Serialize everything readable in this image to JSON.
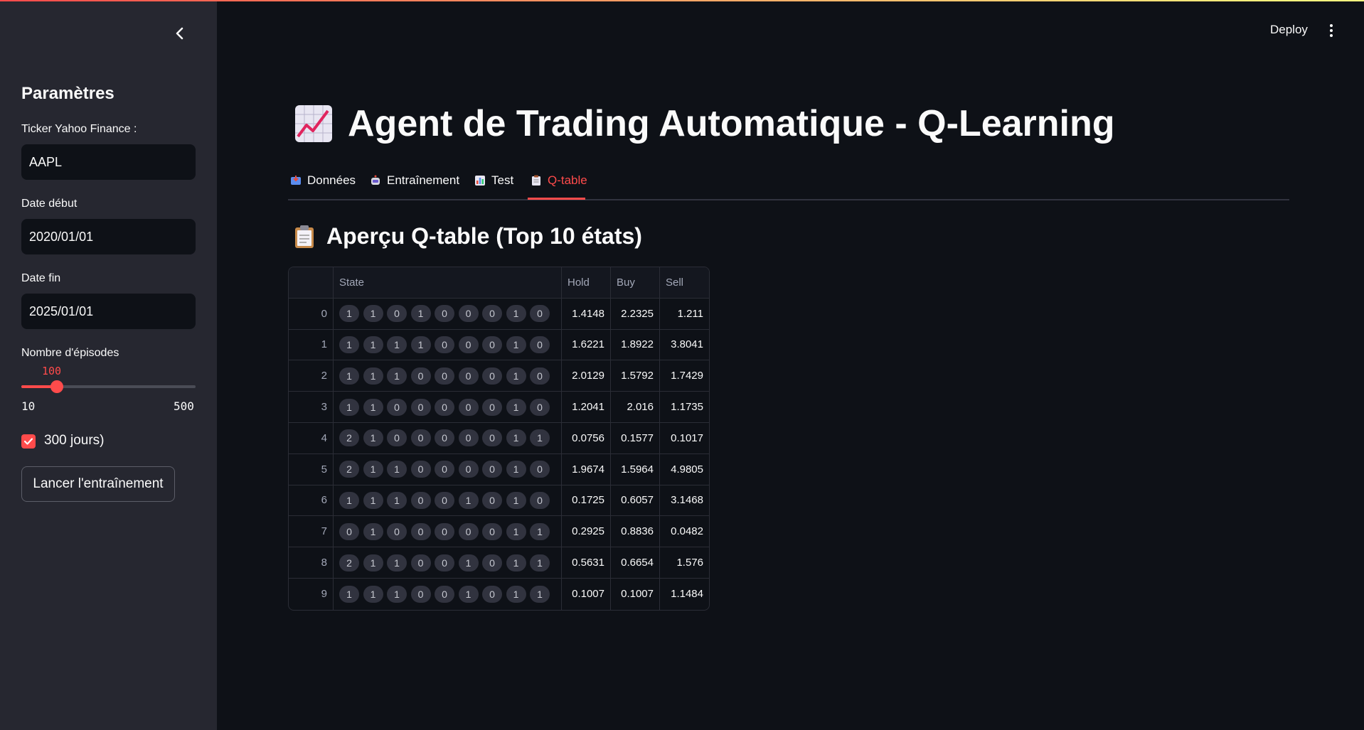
{
  "colors": {
    "accent": "#ff4b4b",
    "sidebar_bg": "#262730",
    "main_bg": "#0e1117"
  },
  "sidebar": {
    "collapse_icon": "chevron-left-icon",
    "title": "Paramètres",
    "ticker_label": "Ticker Yahoo Finance :",
    "ticker_value": "AAPL",
    "start_label": "Date début",
    "start_value": "2020/01/01",
    "end_label": "Date fin",
    "end_value": "2025/01/01",
    "episodes_label": "Nombre d'épisodes",
    "episodes_value": "100",
    "episodes_min": "10",
    "episodes_max": "500",
    "checkbox_checked": true,
    "checkbox_label": "300 jours)",
    "train_button": "Lancer l'entraînement"
  },
  "header": {
    "deploy": "Deploy",
    "menu_icon": "more-vertical-icon"
  },
  "main": {
    "title": "Agent de Trading Automatique - Q-Learning",
    "title_icon": "chart-increasing-icon",
    "tabs": [
      {
        "label": "Données",
        "icon": "inbox-icon"
      },
      {
        "label": "Entraînement",
        "icon": "robot-icon"
      },
      {
        "label": "Test",
        "icon": "bar-chart-icon"
      },
      {
        "label": "Q-table",
        "icon": "clipboard-icon",
        "active": true
      }
    ],
    "section_title": "Aperçu Q-table (Top 10 états)",
    "section_icon": "clipboard-icon",
    "table": {
      "columns": [
        "",
        "State",
        "Hold",
        "Buy",
        "Sell"
      ],
      "rows": [
        {
          "index": "0",
          "state": [
            "1",
            "1",
            "0",
            "1",
            "0",
            "0",
            "0",
            "1",
            "0"
          ],
          "hold": "1.4148",
          "buy": "2.2325",
          "sell": "1.211"
        },
        {
          "index": "1",
          "state": [
            "1",
            "1",
            "1",
            "1",
            "0",
            "0",
            "0",
            "1",
            "0"
          ],
          "hold": "1.6221",
          "buy": "1.8922",
          "sell": "3.8041"
        },
        {
          "index": "2",
          "state": [
            "1",
            "1",
            "1",
            "0",
            "0",
            "0",
            "0",
            "1",
            "0"
          ],
          "hold": "2.0129",
          "buy": "1.5792",
          "sell": "1.7429"
        },
        {
          "index": "3",
          "state": [
            "1",
            "1",
            "0",
            "0",
            "0",
            "0",
            "0",
            "1",
            "0"
          ],
          "hold": "1.2041",
          "buy": "2.016",
          "sell": "1.1735"
        },
        {
          "index": "4",
          "state": [
            "2",
            "1",
            "0",
            "0",
            "0",
            "0",
            "0",
            "1",
            "1"
          ],
          "hold": "0.0756",
          "buy": "0.1577",
          "sell": "0.1017"
        },
        {
          "index": "5",
          "state": [
            "2",
            "1",
            "1",
            "0",
            "0",
            "0",
            "0",
            "1",
            "0"
          ],
          "hold": "1.9674",
          "buy": "1.5964",
          "sell": "4.9805"
        },
        {
          "index": "6",
          "state": [
            "1",
            "1",
            "1",
            "0",
            "0",
            "1",
            "0",
            "1",
            "0"
          ],
          "hold": "0.1725",
          "buy": "0.6057",
          "sell": "3.1468"
        },
        {
          "index": "7",
          "state": [
            "0",
            "1",
            "0",
            "0",
            "0",
            "0",
            "0",
            "1",
            "1"
          ],
          "hold": "0.2925",
          "buy": "0.8836",
          "sell": "0.0482"
        },
        {
          "index": "8",
          "state": [
            "2",
            "1",
            "1",
            "0",
            "0",
            "1",
            "0",
            "1",
            "1"
          ],
          "hold": "0.5631",
          "buy": "0.6654",
          "sell": "1.576"
        },
        {
          "index": "9",
          "state": [
            "1",
            "1",
            "1",
            "0",
            "0",
            "1",
            "0",
            "1",
            "1"
          ],
          "hold": "0.1007",
          "buy": "0.1007",
          "sell": "1.1484"
        }
      ]
    }
  }
}
